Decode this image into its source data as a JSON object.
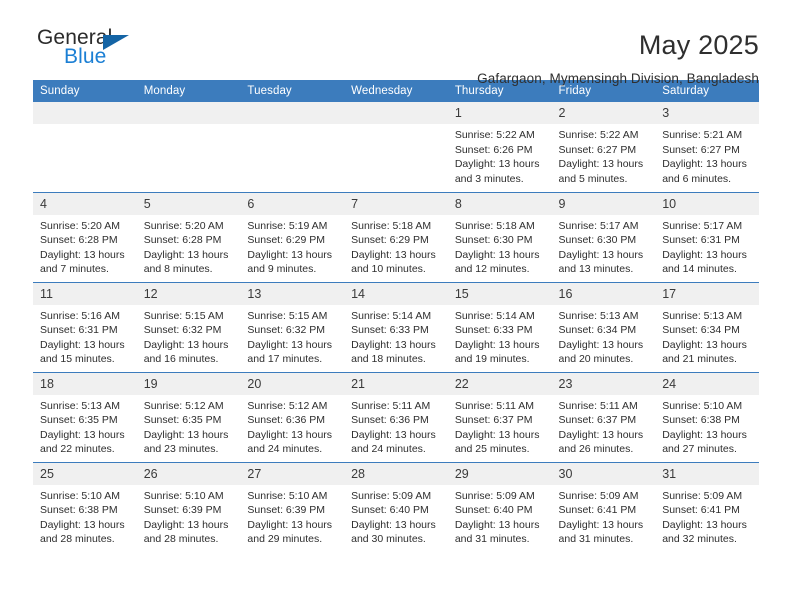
{
  "brand": {
    "name_part1": "General",
    "name_part2": "Blue",
    "triangle_icon": "triangle-logo-icon",
    "color_dark": "#2b2b2b",
    "color_blue": "#1b7fd4",
    "triangle_color": "#1464a5"
  },
  "header": {
    "title": "May 2025",
    "subtitle": "Gafargaon, Mymensingh Division, Bangladesh"
  },
  "theme": {
    "header_bg": "#3c7cbd",
    "header_text": "#ffffff",
    "daynum_bg": "#f0f0f0",
    "cell_text": "#2e2e2e"
  },
  "weekday_headers": [
    "Sunday",
    "Monday",
    "Tuesday",
    "Wednesday",
    "Thursday",
    "Friday",
    "Saturday"
  ],
  "weeks": [
    [
      {
        "day": "",
        "empty": true,
        "sunrise": "",
        "sunset": "",
        "daylight1": "",
        "daylight2": ""
      },
      {
        "day": "",
        "empty": true,
        "sunrise": "",
        "sunset": "",
        "daylight1": "",
        "daylight2": ""
      },
      {
        "day": "",
        "empty": true,
        "sunrise": "",
        "sunset": "",
        "daylight1": "",
        "daylight2": ""
      },
      {
        "day": "",
        "empty": true,
        "sunrise": "",
        "sunset": "",
        "daylight1": "",
        "daylight2": ""
      },
      {
        "day": "1",
        "empty": false,
        "sunrise": "Sunrise: 5:22 AM",
        "sunset": "Sunset: 6:26 PM",
        "daylight1": "Daylight: 13 hours",
        "daylight2": "and 3 minutes."
      },
      {
        "day": "2",
        "empty": false,
        "sunrise": "Sunrise: 5:22 AM",
        "sunset": "Sunset: 6:27 PM",
        "daylight1": "Daylight: 13 hours",
        "daylight2": "and 5 minutes."
      },
      {
        "day": "3",
        "empty": false,
        "sunrise": "Sunrise: 5:21 AM",
        "sunset": "Sunset: 6:27 PM",
        "daylight1": "Daylight: 13 hours",
        "daylight2": "and 6 minutes."
      }
    ],
    [
      {
        "day": "4",
        "empty": false,
        "sunrise": "Sunrise: 5:20 AM",
        "sunset": "Sunset: 6:28 PM",
        "daylight1": "Daylight: 13 hours",
        "daylight2": "and 7 minutes."
      },
      {
        "day": "5",
        "empty": false,
        "sunrise": "Sunrise: 5:20 AM",
        "sunset": "Sunset: 6:28 PM",
        "daylight1": "Daylight: 13 hours",
        "daylight2": "and 8 minutes."
      },
      {
        "day": "6",
        "empty": false,
        "sunrise": "Sunrise: 5:19 AM",
        "sunset": "Sunset: 6:29 PM",
        "daylight1": "Daylight: 13 hours",
        "daylight2": "and 9 minutes."
      },
      {
        "day": "7",
        "empty": false,
        "sunrise": "Sunrise: 5:18 AM",
        "sunset": "Sunset: 6:29 PM",
        "daylight1": "Daylight: 13 hours",
        "daylight2": "and 10 minutes."
      },
      {
        "day": "8",
        "empty": false,
        "sunrise": "Sunrise: 5:18 AM",
        "sunset": "Sunset: 6:30 PM",
        "daylight1": "Daylight: 13 hours",
        "daylight2": "and 12 minutes."
      },
      {
        "day": "9",
        "empty": false,
        "sunrise": "Sunrise: 5:17 AM",
        "sunset": "Sunset: 6:30 PM",
        "daylight1": "Daylight: 13 hours",
        "daylight2": "and 13 minutes."
      },
      {
        "day": "10",
        "empty": false,
        "sunrise": "Sunrise: 5:17 AM",
        "sunset": "Sunset: 6:31 PM",
        "daylight1": "Daylight: 13 hours",
        "daylight2": "and 14 minutes."
      }
    ],
    [
      {
        "day": "11",
        "empty": false,
        "sunrise": "Sunrise: 5:16 AM",
        "sunset": "Sunset: 6:31 PM",
        "daylight1": "Daylight: 13 hours",
        "daylight2": "and 15 minutes."
      },
      {
        "day": "12",
        "empty": false,
        "sunrise": "Sunrise: 5:15 AM",
        "sunset": "Sunset: 6:32 PM",
        "daylight1": "Daylight: 13 hours",
        "daylight2": "and 16 minutes."
      },
      {
        "day": "13",
        "empty": false,
        "sunrise": "Sunrise: 5:15 AM",
        "sunset": "Sunset: 6:32 PM",
        "daylight1": "Daylight: 13 hours",
        "daylight2": "and 17 minutes."
      },
      {
        "day": "14",
        "empty": false,
        "sunrise": "Sunrise: 5:14 AM",
        "sunset": "Sunset: 6:33 PM",
        "daylight1": "Daylight: 13 hours",
        "daylight2": "and 18 minutes."
      },
      {
        "day": "15",
        "empty": false,
        "sunrise": "Sunrise: 5:14 AM",
        "sunset": "Sunset: 6:33 PM",
        "daylight1": "Daylight: 13 hours",
        "daylight2": "and 19 minutes."
      },
      {
        "day": "16",
        "empty": false,
        "sunrise": "Sunrise: 5:13 AM",
        "sunset": "Sunset: 6:34 PM",
        "daylight1": "Daylight: 13 hours",
        "daylight2": "and 20 minutes."
      },
      {
        "day": "17",
        "empty": false,
        "sunrise": "Sunrise: 5:13 AM",
        "sunset": "Sunset: 6:34 PM",
        "daylight1": "Daylight: 13 hours",
        "daylight2": "and 21 minutes."
      }
    ],
    [
      {
        "day": "18",
        "empty": false,
        "sunrise": "Sunrise: 5:13 AM",
        "sunset": "Sunset: 6:35 PM",
        "daylight1": "Daylight: 13 hours",
        "daylight2": "and 22 minutes."
      },
      {
        "day": "19",
        "empty": false,
        "sunrise": "Sunrise: 5:12 AM",
        "sunset": "Sunset: 6:35 PM",
        "daylight1": "Daylight: 13 hours",
        "daylight2": "and 23 minutes."
      },
      {
        "day": "20",
        "empty": false,
        "sunrise": "Sunrise: 5:12 AM",
        "sunset": "Sunset: 6:36 PM",
        "daylight1": "Daylight: 13 hours",
        "daylight2": "and 24 minutes."
      },
      {
        "day": "21",
        "empty": false,
        "sunrise": "Sunrise: 5:11 AM",
        "sunset": "Sunset: 6:36 PM",
        "daylight1": "Daylight: 13 hours",
        "daylight2": "and 24 minutes."
      },
      {
        "day": "22",
        "empty": false,
        "sunrise": "Sunrise: 5:11 AM",
        "sunset": "Sunset: 6:37 PM",
        "daylight1": "Daylight: 13 hours",
        "daylight2": "and 25 minutes."
      },
      {
        "day": "23",
        "empty": false,
        "sunrise": "Sunrise: 5:11 AM",
        "sunset": "Sunset: 6:37 PM",
        "daylight1": "Daylight: 13 hours",
        "daylight2": "and 26 minutes."
      },
      {
        "day": "24",
        "empty": false,
        "sunrise": "Sunrise: 5:10 AM",
        "sunset": "Sunset: 6:38 PM",
        "daylight1": "Daylight: 13 hours",
        "daylight2": "and 27 minutes."
      }
    ],
    [
      {
        "day": "25",
        "empty": false,
        "sunrise": "Sunrise: 5:10 AM",
        "sunset": "Sunset: 6:38 PM",
        "daylight1": "Daylight: 13 hours",
        "daylight2": "and 28 minutes."
      },
      {
        "day": "26",
        "empty": false,
        "sunrise": "Sunrise: 5:10 AM",
        "sunset": "Sunset: 6:39 PM",
        "daylight1": "Daylight: 13 hours",
        "daylight2": "and 28 minutes."
      },
      {
        "day": "27",
        "empty": false,
        "sunrise": "Sunrise: 5:10 AM",
        "sunset": "Sunset: 6:39 PM",
        "daylight1": "Daylight: 13 hours",
        "daylight2": "and 29 minutes."
      },
      {
        "day": "28",
        "empty": false,
        "sunrise": "Sunrise: 5:09 AM",
        "sunset": "Sunset: 6:40 PM",
        "daylight1": "Daylight: 13 hours",
        "daylight2": "and 30 minutes."
      },
      {
        "day": "29",
        "empty": false,
        "sunrise": "Sunrise: 5:09 AM",
        "sunset": "Sunset: 6:40 PM",
        "daylight1": "Daylight: 13 hours",
        "daylight2": "and 31 minutes."
      },
      {
        "day": "30",
        "empty": false,
        "sunrise": "Sunrise: 5:09 AM",
        "sunset": "Sunset: 6:41 PM",
        "daylight1": "Daylight: 13 hours",
        "daylight2": "and 31 minutes."
      },
      {
        "day": "31",
        "empty": false,
        "sunrise": "Sunrise: 5:09 AM",
        "sunset": "Sunset: 6:41 PM",
        "daylight1": "Daylight: 13 hours",
        "daylight2": "and 32 minutes."
      }
    ]
  ]
}
